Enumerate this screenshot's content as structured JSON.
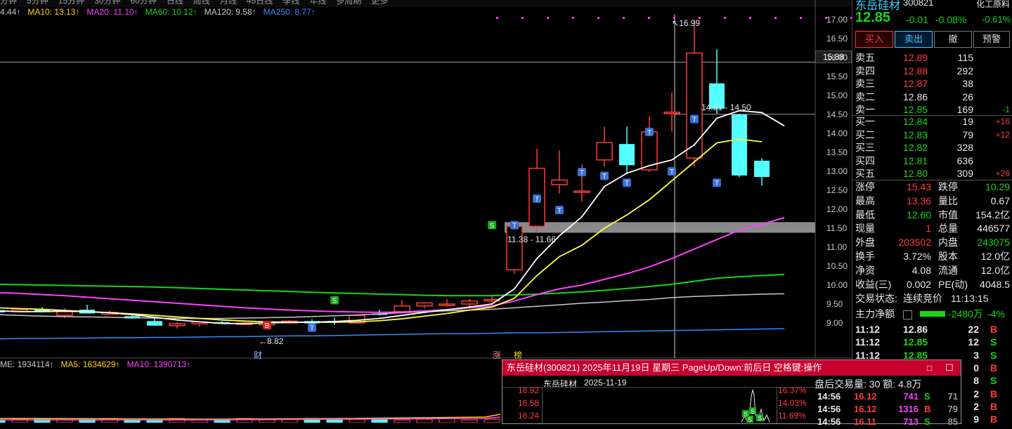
{
  "topbar": {
    "items": [
      "分钟",
      "5分钟",
      "15分钟",
      "30分钟",
      "60分钟",
      "日线",
      "周线",
      "月线",
      "45日线",
      "季线",
      "年线",
      "多周期",
      "更多"
    ]
  },
  "legend": [
    {
      "label": "4.44↑",
      "color": "#c8c8c8"
    },
    {
      "label": "MA10: 13.13↑",
      "color": "#ffd400"
    },
    {
      "label": "MA20: 11.10↑",
      "color": "#ff40ff"
    },
    {
      "label": "MA60: 10.12↑",
      "color": "#16d616"
    },
    {
      "label": "MA120: 9.58↑",
      "color": "#c8c8c8"
    },
    {
      "label": "MA250: 8.77↑",
      "color": "#2f8fff"
    }
  ],
  "vol_legend": [
    {
      "label": "ME: 1934114↑",
      "color": "#c8c8c8"
    },
    {
      "label": "MA5: 1634629↑",
      "color": "#ffd400"
    },
    {
      "label": "MA10: 1390713↑",
      "color": "#ff40ff"
    }
  ],
  "axis": {
    "ticks": [
      "17.00",
      "16.50",
      "16.00",
      "15.50",
      "15.00",
      "14.50",
      "14.00",
      "13.50",
      "13.00",
      "12.50",
      "12.00",
      "11.50",
      "11.00",
      "10.50",
      "10.00",
      "9.50",
      "9.00"
    ],
    "current_line_label": "15.88"
  },
  "annotations": {
    "high": "16.99",
    "low": "8.82",
    "range_upper": "14.51 - 14.50",
    "range_lower": "11.38 - 11.66",
    "cai": "财",
    "zhang": "涨",
    "bang": "榜"
  },
  "chart_data": {
    "type": "candlestick",
    "candles": [
      {
        "o": 9.34,
        "h": 9.38,
        "l": 9.28,
        "c": 9.28
      },
      {
        "o": 9.3,
        "h": 9.39,
        "l": 9.28,
        "c": 9.35
      },
      {
        "o": 9.35,
        "h": 9.42,
        "l": 9.31,
        "c": 9.34
      },
      {
        "o": 9.2,
        "h": 9.38,
        "l": 9.13,
        "c": 9.3
      },
      {
        "o": 9.35,
        "h": 9.48,
        "l": 9.25,
        "c": 9.25
      },
      {
        "o": 9.23,
        "h": 9.33,
        "l": 9.22,
        "c": 9.28
      },
      {
        "o": 9.18,
        "h": 9.22,
        "l": 9.11,
        "c": 9.12
      },
      {
        "o": 9.05,
        "h": 9.12,
        "l": 8.93,
        "c": 8.93
      },
      {
        "o": 8.93,
        "h": 9.01,
        "l": 8.85,
        "c": 8.98
      },
      {
        "o": 8.98,
        "h": 9.05,
        "l": 8.9,
        "c": 9.03
      },
      {
        "o": 9.02,
        "h": 9.05,
        "l": 8.98,
        "c": 9.0
      },
      {
        "o": 9.0,
        "h": 9.03,
        "l": 8.97,
        "c": 9.0
      },
      {
        "o": 8.95,
        "h": 9.02,
        "l": 8.82,
        "c": 9.0
      },
      {
        "o": 9.0,
        "h": 9.08,
        "l": 8.98,
        "c": 9.05
      },
      {
        "o": 9.05,
        "h": 9.1,
        "l": 8.97,
        "c": 8.99
      },
      {
        "o": 9.05,
        "h": 9.14,
        "l": 8.95,
        "c": 9.03
      },
      {
        "o": 9.0,
        "h": 9.2,
        "l": 8.98,
        "c": 9.2
      },
      {
        "o": 9.25,
        "h": 9.35,
        "l": 9.2,
        "c": 9.22
      },
      {
        "o": 9.3,
        "h": 9.6,
        "l": 9.25,
        "c": 9.45
      },
      {
        "o": 9.45,
        "h": 9.53,
        "l": 9.38,
        "c": 9.53
      },
      {
        "o": 9.5,
        "h": 9.63,
        "l": 9.42,
        "c": 9.5
      },
      {
        "o": 9.5,
        "h": 9.63,
        "l": 9.42,
        "c": 9.58
      },
      {
        "o": 9.6,
        "h": 9.7,
        "l": 9.55,
        "c": 9.62
      },
      {
        "o": 10.4,
        "h": 11.55,
        "l": 10.3,
        "c": 11.55
      },
      {
        "o": 11.55,
        "h": 13.6,
        "l": 11.4,
        "c": 13.08
      },
      {
        "o": 12.65,
        "h": 13.55,
        "l": 12.42,
        "c": 12.77
      },
      {
        "o": 12.48,
        "h": 13.18,
        "l": 12.2,
        "c": 12.48
      },
      {
        "o": 13.3,
        "h": 14.18,
        "l": 13.12,
        "c": 13.76
      },
      {
        "o": 13.72,
        "h": 14.18,
        "l": 12.94,
        "c": 13.16
      },
      {
        "o": 13.04,
        "h": 14.45,
        "l": 12.98,
        "c": 14.04
      },
      {
        "o": 14.54,
        "h": 15.08,
        "l": 14.05,
        "c": 14.56
      },
      {
        "o": 13.35,
        "h": 16.99,
        "l": 13.12,
        "c": 16.12
      },
      {
        "o": 15.32,
        "h": 16.22,
        "l": 14.52,
        "c": 14.65
      },
      {
        "o": 14.5,
        "h": 14.52,
        "l": 12.85,
        "c": 12.89
      },
      {
        "o": 13.28,
        "h": 13.35,
        "l": 12.62,
        "c": 12.85
      }
    ],
    "ma10": [
      9.4,
      9.38,
      9.36,
      9.33,
      9.3,
      9.27,
      9.24,
      9.2,
      9.16,
      9.12,
      9.08,
      9.05,
      9.03,
      9.02,
      9.02,
      9.02,
      9.03,
      9.06,
      9.11,
      9.18,
      9.25,
      9.34,
      9.42,
      9.65,
      10.25,
      10.75,
      11.05,
      11.5,
      11.85,
      12.25,
      12.75,
      13.25,
      13.75,
      13.85,
      13.78
    ],
    "ma5": [
      9.32,
      9.3,
      9.3,
      9.31,
      9.3,
      9.27,
      9.22,
      9.15,
      9.08,
      9.03,
      8.99,
      8.98,
      9.0,
      9.02,
      9.02,
      9.04,
      9.07,
      9.12,
      9.2,
      9.28,
      9.35,
      9.42,
      9.5,
      9.9,
      10.7,
      11.3,
      11.8,
      12.6,
      12.95,
      13.15,
      13.3,
      13.7,
      14.4,
      14.6,
      14.55,
      14.2
    ],
    "ma20": [
      9.8,
      9.78,
      9.75,
      9.72,
      9.68,
      9.64,
      9.6,
      9.56,
      9.52,
      9.48,
      9.44,
      9.4,
      9.37,
      9.34,
      9.32,
      9.3,
      9.29,
      9.28,
      9.29,
      9.32,
      9.35,
      9.4,
      9.45,
      9.58,
      9.75,
      9.9,
      10.0,
      10.15,
      10.3,
      10.48,
      10.7,
      10.95,
      11.2,
      11.45,
      11.6,
      11.78
    ],
    "ma60": [
      10.02,
      10.01,
      10.0,
      9.99,
      9.98,
      9.97,
      9.96,
      9.95,
      9.93,
      9.91,
      9.89,
      9.87,
      9.85,
      9.83,
      9.81,
      9.79,
      9.78,
      9.76,
      9.75,
      9.73,
      9.72,
      9.72,
      9.72,
      9.74,
      9.76,
      9.79,
      9.82,
      9.86,
      9.91,
      9.96,
      10.02,
      10.1,
      10.18,
      10.22,
      10.25,
      10.28
    ],
    "ma120": [
      9.22,
      9.2,
      9.18,
      9.17,
      9.16,
      9.15,
      9.14,
      9.13,
      9.12,
      9.12,
      9.12,
      9.13,
      9.14,
      9.15,
      9.17,
      9.19,
      9.21,
      9.24,
      9.27,
      9.3,
      9.32,
      9.34,
      9.36,
      9.4,
      9.44,
      9.48,
      9.52,
      9.55,
      9.59,
      9.62,
      9.67,
      9.7,
      9.72,
      9.74,
      9.76,
      9.77
    ],
    "ma250": [
      8.58,
      8.59,
      8.59,
      8.6,
      8.6,
      8.61,
      8.61,
      8.62,
      8.62,
      8.63,
      8.64,
      8.64,
      8.65,
      8.66,
      8.66,
      8.67,
      8.68,
      8.69,
      8.7,
      8.71,
      8.72,
      8.72,
      8.73,
      8.74,
      8.74,
      8.75,
      8.76,
      8.77,
      8.78,
      8.79,
      8.8,
      8.81,
      8.82,
      8.83,
      8.84,
      8.85
    ],
    "ylim": [
      8.6,
      17.25
    ]
  },
  "quote": {
    "name": "东岳硅材",
    "code": "300821",
    "sector": "化工原料",
    "price": "12.85",
    "change": "-0.01",
    "pct": "-0.08%",
    "sector_pct": "-0.61%",
    "buttons": [
      "买入",
      "卖出",
      "撤",
      "预警"
    ]
  },
  "asks": [
    {
      "label": "卖五",
      "price": "12.89",
      "vol": "115",
      "chg": ""
    },
    {
      "label": "卖四",
      "price": "12.88",
      "vol": "292",
      "chg": ""
    },
    {
      "label": "卖三",
      "price": "12.87",
      "vol": "38",
      "chg": ""
    },
    {
      "label": "卖二",
      "price": "12.86",
      "vol": "26",
      "chg": ""
    },
    {
      "label": "卖一",
      "price": "12.85",
      "vol": "169",
      "chg": "-1"
    }
  ],
  "bids": [
    {
      "label": "买一",
      "price": "12.84",
      "vol": "19",
      "chg": "+16"
    },
    {
      "label": "买二",
      "price": "12.83",
      "vol": "79",
      "chg": "+12"
    },
    {
      "label": "买三",
      "price": "12.82",
      "vol": "328",
      "chg": ""
    },
    {
      "label": "买四",
      "price": "12.81",
      "vol": "636",
      "chg": ""
    },
    {
      "label": "买五",
      "price": "12.80",
      "vol": "309",
      "chg": "+26"
    }
  ],
  "stats": [
    {
      "l1": "涨停",
      "v1": "15.43",
      "c1": "red",
      "l2": "跌停",
      "v2": "10.29",
      "c2": "green"
    },
    {
      "l1": "最高",
      "v1": "13.36",
      "c1": "red",
      "l2": "量比",
      "v2": "0.67",
      "c2": "white"
    },
    {
      "l1": "最低",
      "v1": "12.60",
      "c1": "green",
      "l2": "市值",
      "v2": "154.2亿",
      "c2": "white"
    },
    {
      "l1": "现量",
      "v1": "1",
      "c1": "red",
      "l2": "总量",
      "v2": "446577",
      "c2": "white"
    },
    {
      "l1": "外盘",
      "v1": "203502",
      "c1": "red",
      "l2": "内盘",
      "v2": "243075",
      "c2": "green"
    },
    {
      "l1": "换手",
      "v1": "3.72%",
      "c1": "white",
      "l2": "股本",
      "v2": "12.0亿",
      "c2": "white"
    },
    {
      "l1": "净资",
      "v1": "4.08",
      "c1": "white",
      "l2": "流通",
      "v2": "12.0亿",
      "c2": "white"
    },
    {
      "l1": "收益(三)",
      "v1": "0.002",
      "c1": "white",
      "l2": "PE(动)",
      "v2": "4048.5",
      "c2": "white"
    }
  ],
  "trade_status": {
    "label": "交易状态:",
    "value": "连续竞价",
    "time": "11:13:15"
  },
  "main_flow": {
    "label": "主力净额",
    "value": "-2480万",
    "pct": "-4%"
  },
  "ticks": [
    {
      "t": "11:12",
      "p": "12.86",
      "pc": "white",
      "v": "22",
      "s": "B"
    },
    {
      "t": "11:12",
      "p": "12.85",
      "pc": "green",
      "v": "12",
      "s": "S"
    },
    {
      "t": "11:12",
      "p": "12.85",
      "pc": "green",
      "v": "3",
      "s": "S"
    },
    {
      "t": "",
      "p": "",
      "pc": "white",
      "v": "0",
      "s": "B"
    },
    {
      "t": "",
      "p": "",
      "pc": "white",
      "v": "8",
      "s": "S"
    },
    {
      "t": "",
      "p": "",
      "pc": "white",
      "v": "2",
      "s": "B"
    },
    {
      "t": "",
      "p": "",
      "pc": "white",
      "v": "2",
      "s": "B"
    },
    {
      "t": "",
      "p": "",
      "pc": "white",
      "v": "9",
      "s": "B"
    }
  ],
  "popup": {
    "title": "东岳硅材(300821) 2025年11月19日 星期三 PageUp/Down:前后日 空格键:操作",
    "stock": "东岳硅材",
    "date": "2025-11-19",
    "prices": [
      "16.92",
      "16.58",
      "16.24"
    ],
    "pcts": [
      "16.37%",
      "14.03%",
      "11.69%"
    ],
    "after_label": "盘后交易量: 30 额: 4.8万",
    "rows": [
      {
        "t": "14:56",
        "p": "16.12",
        "v": "741",
        "s": "S",
        "n": "71"
      },
      {
        "t": "14:56",
        "p": "16.12",
        "v": "1316",
        "s": "B",
        "n": "79"
      },
      {
        "t": "14:56",
        "p": "16.11",
        "v": "713",
        "s": "S",
        "n": "85"
      }
    ]
  }
}
